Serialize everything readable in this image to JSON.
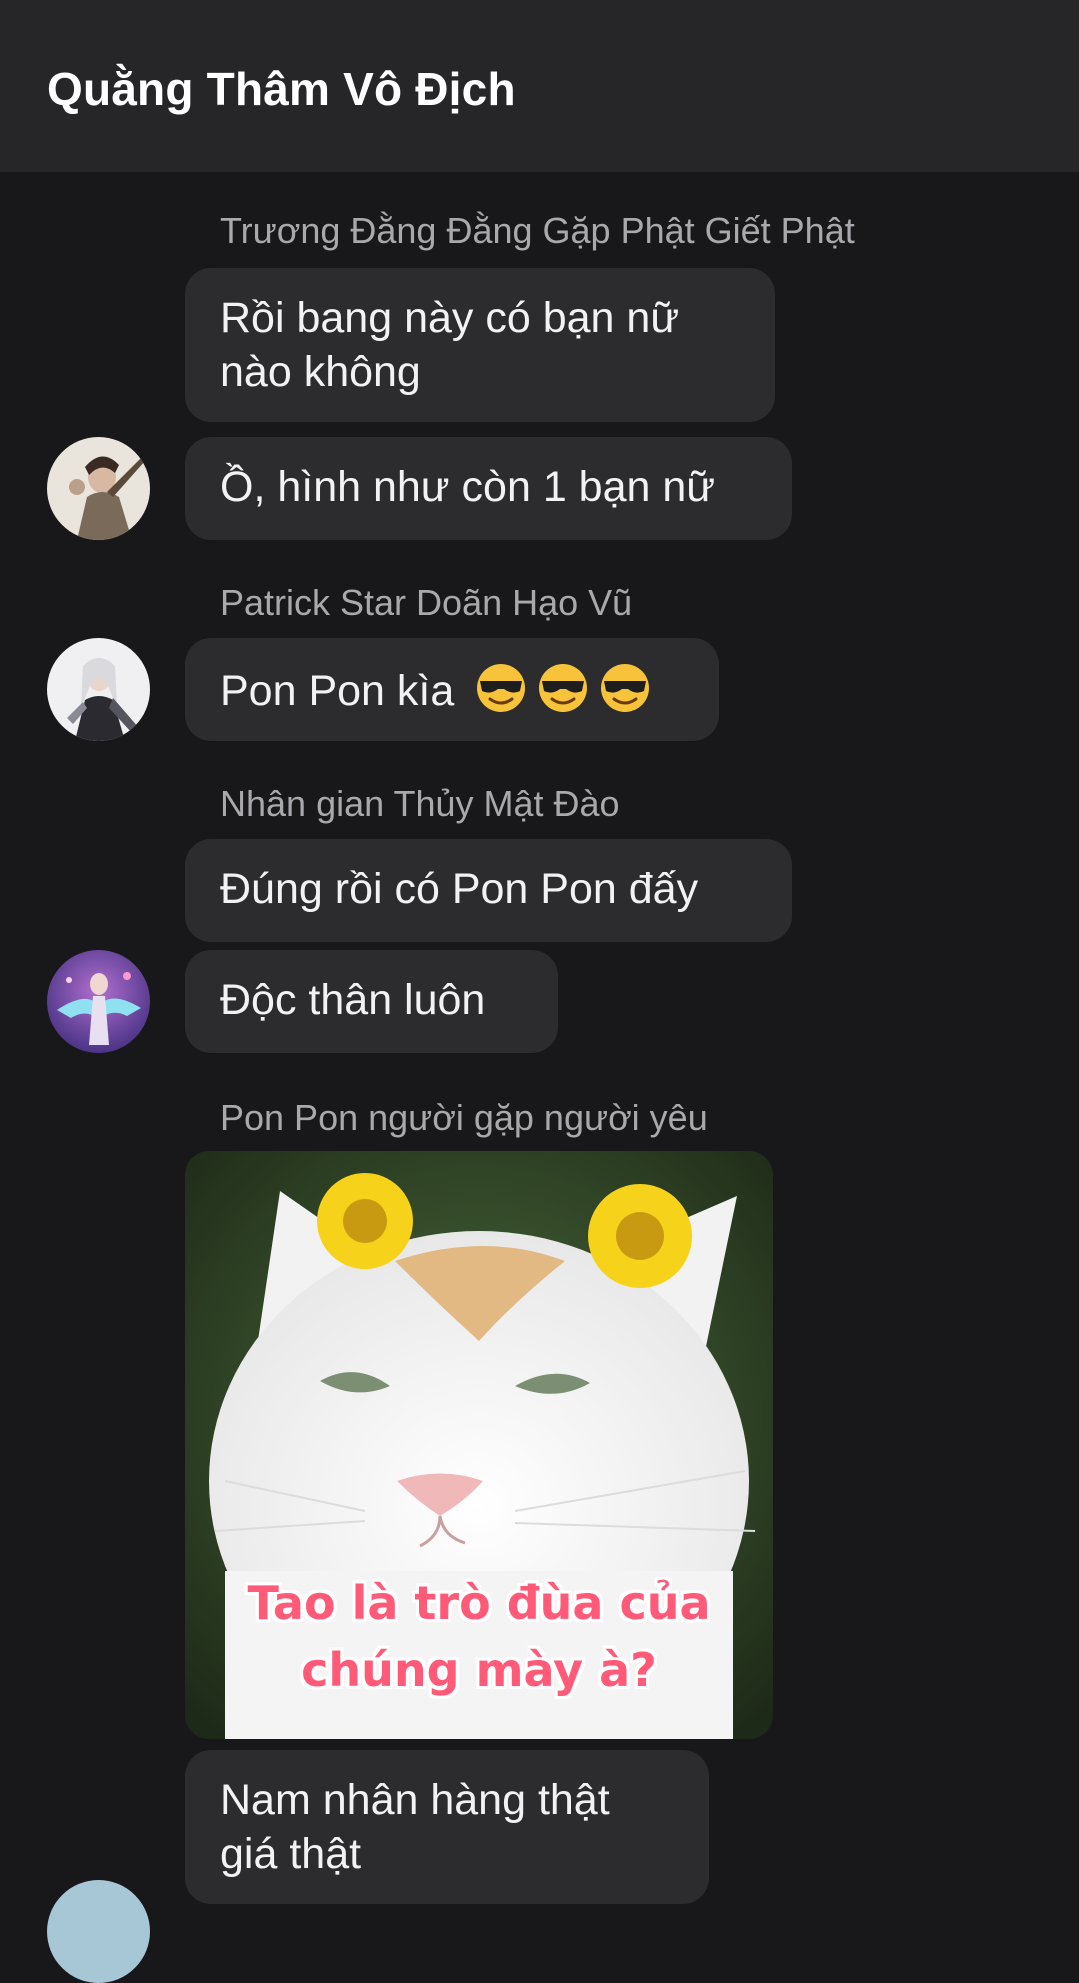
{
  "header": {
    "title": "Quằng Thâm Vô Địch"
  },
  "messages": {
    "group1": {
      "sender": "Trương Đằng Đằng Gặp Phật Giết Phật",
      "bubble1": "Rồi bang này có bạn nữ nào không",
      "bubble2": "Ồ, hình như còn 1 bạn nữ"
    },
    "group2": {
      "sender": "Patrick Star Doãn Hạo Vũ",
      "bubble1": "Pon Pon kìa",
      "emoji": "smiling-face-with-sunglasses-icon"
    },
    "group3": {
      "sender": "Nhân gian Thủy Mật Đào",
      "bubble1": "Đúng rồi có Pon Pon đấy",
      "bubble2": "Độc thân luôn"
    },
    "group4": {
      "sender": "Pon Pon người gặp người yêu",
      "photo_caption_line1": "Tao là trò đùa của",
      "photo_caption_line2": "chúng mày à?",
      "bubble1": "Nam nhân hàng thật giá thật"
    }
  },
  "colors": {
    "background": "#18181a",
    "header": "#262628",
    "bubble": "#2c2c2e",
    "sender_text": "#a8a8ad"
  }
}
